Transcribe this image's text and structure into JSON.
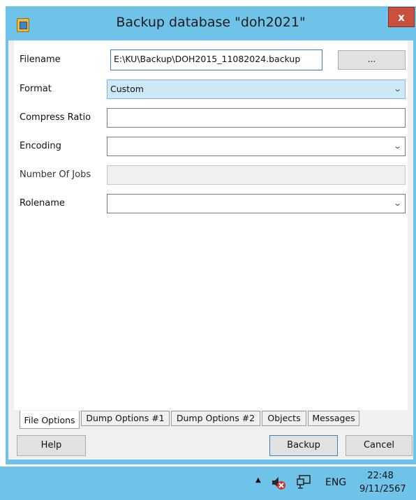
{
  "window": {
    "title": "Backup database \"doh2021\"",
    "close_label": "x"
  },
  "form": {
    "filename": {
      "label": "Filename",
      "value": "E:\\KU\\Backup\\DOH2015_11082024.backup",
      "browse_label": "..."
    },
    "format": {
      "label": "Format",
      "value": "Custom"
    },
    "compress_ratio": {
      "label": "Compress Ratio",
      "value": ""
    },
    "encoding": {
      "label": "Encoding",
      "value": ""
    },
    "number_of_jobs": {
      "label": "Number Of Jobs",
      "value": ""
    },
    "rolename": {
      "label": "Rolename",
      "value": ""
    }
  },
  "tabs": [
    {
      "label": "File Options",
      "active": true
    },
    {
      "label": "Dump Options #1",
      "active": false
    },
    {
      "label": "Dump Options #2",
      "active": false
    },
    {
      "label": "Objects",
      "active": false
    },
    {
      "label": "Messages",
      "active": false
    }
  ],
  "buttons": {
    "help": "Help",
    "backup": "Backup",
    "cancel": "Cancel"
  },
  "taskbar": {
    "language": "ENG",
    "time": "22:48",
    "date": "9/11/2567",
    "icons": [
      "chevron-up-icon",
      "speaker-muted-icon",
      "network-icon"
    ]
  },
  "colors": {
    "window_frame": "#6fc3e8",
    "close_button": "#c7513d",
    "format_highlight": "#cde8f7"
  }
}
